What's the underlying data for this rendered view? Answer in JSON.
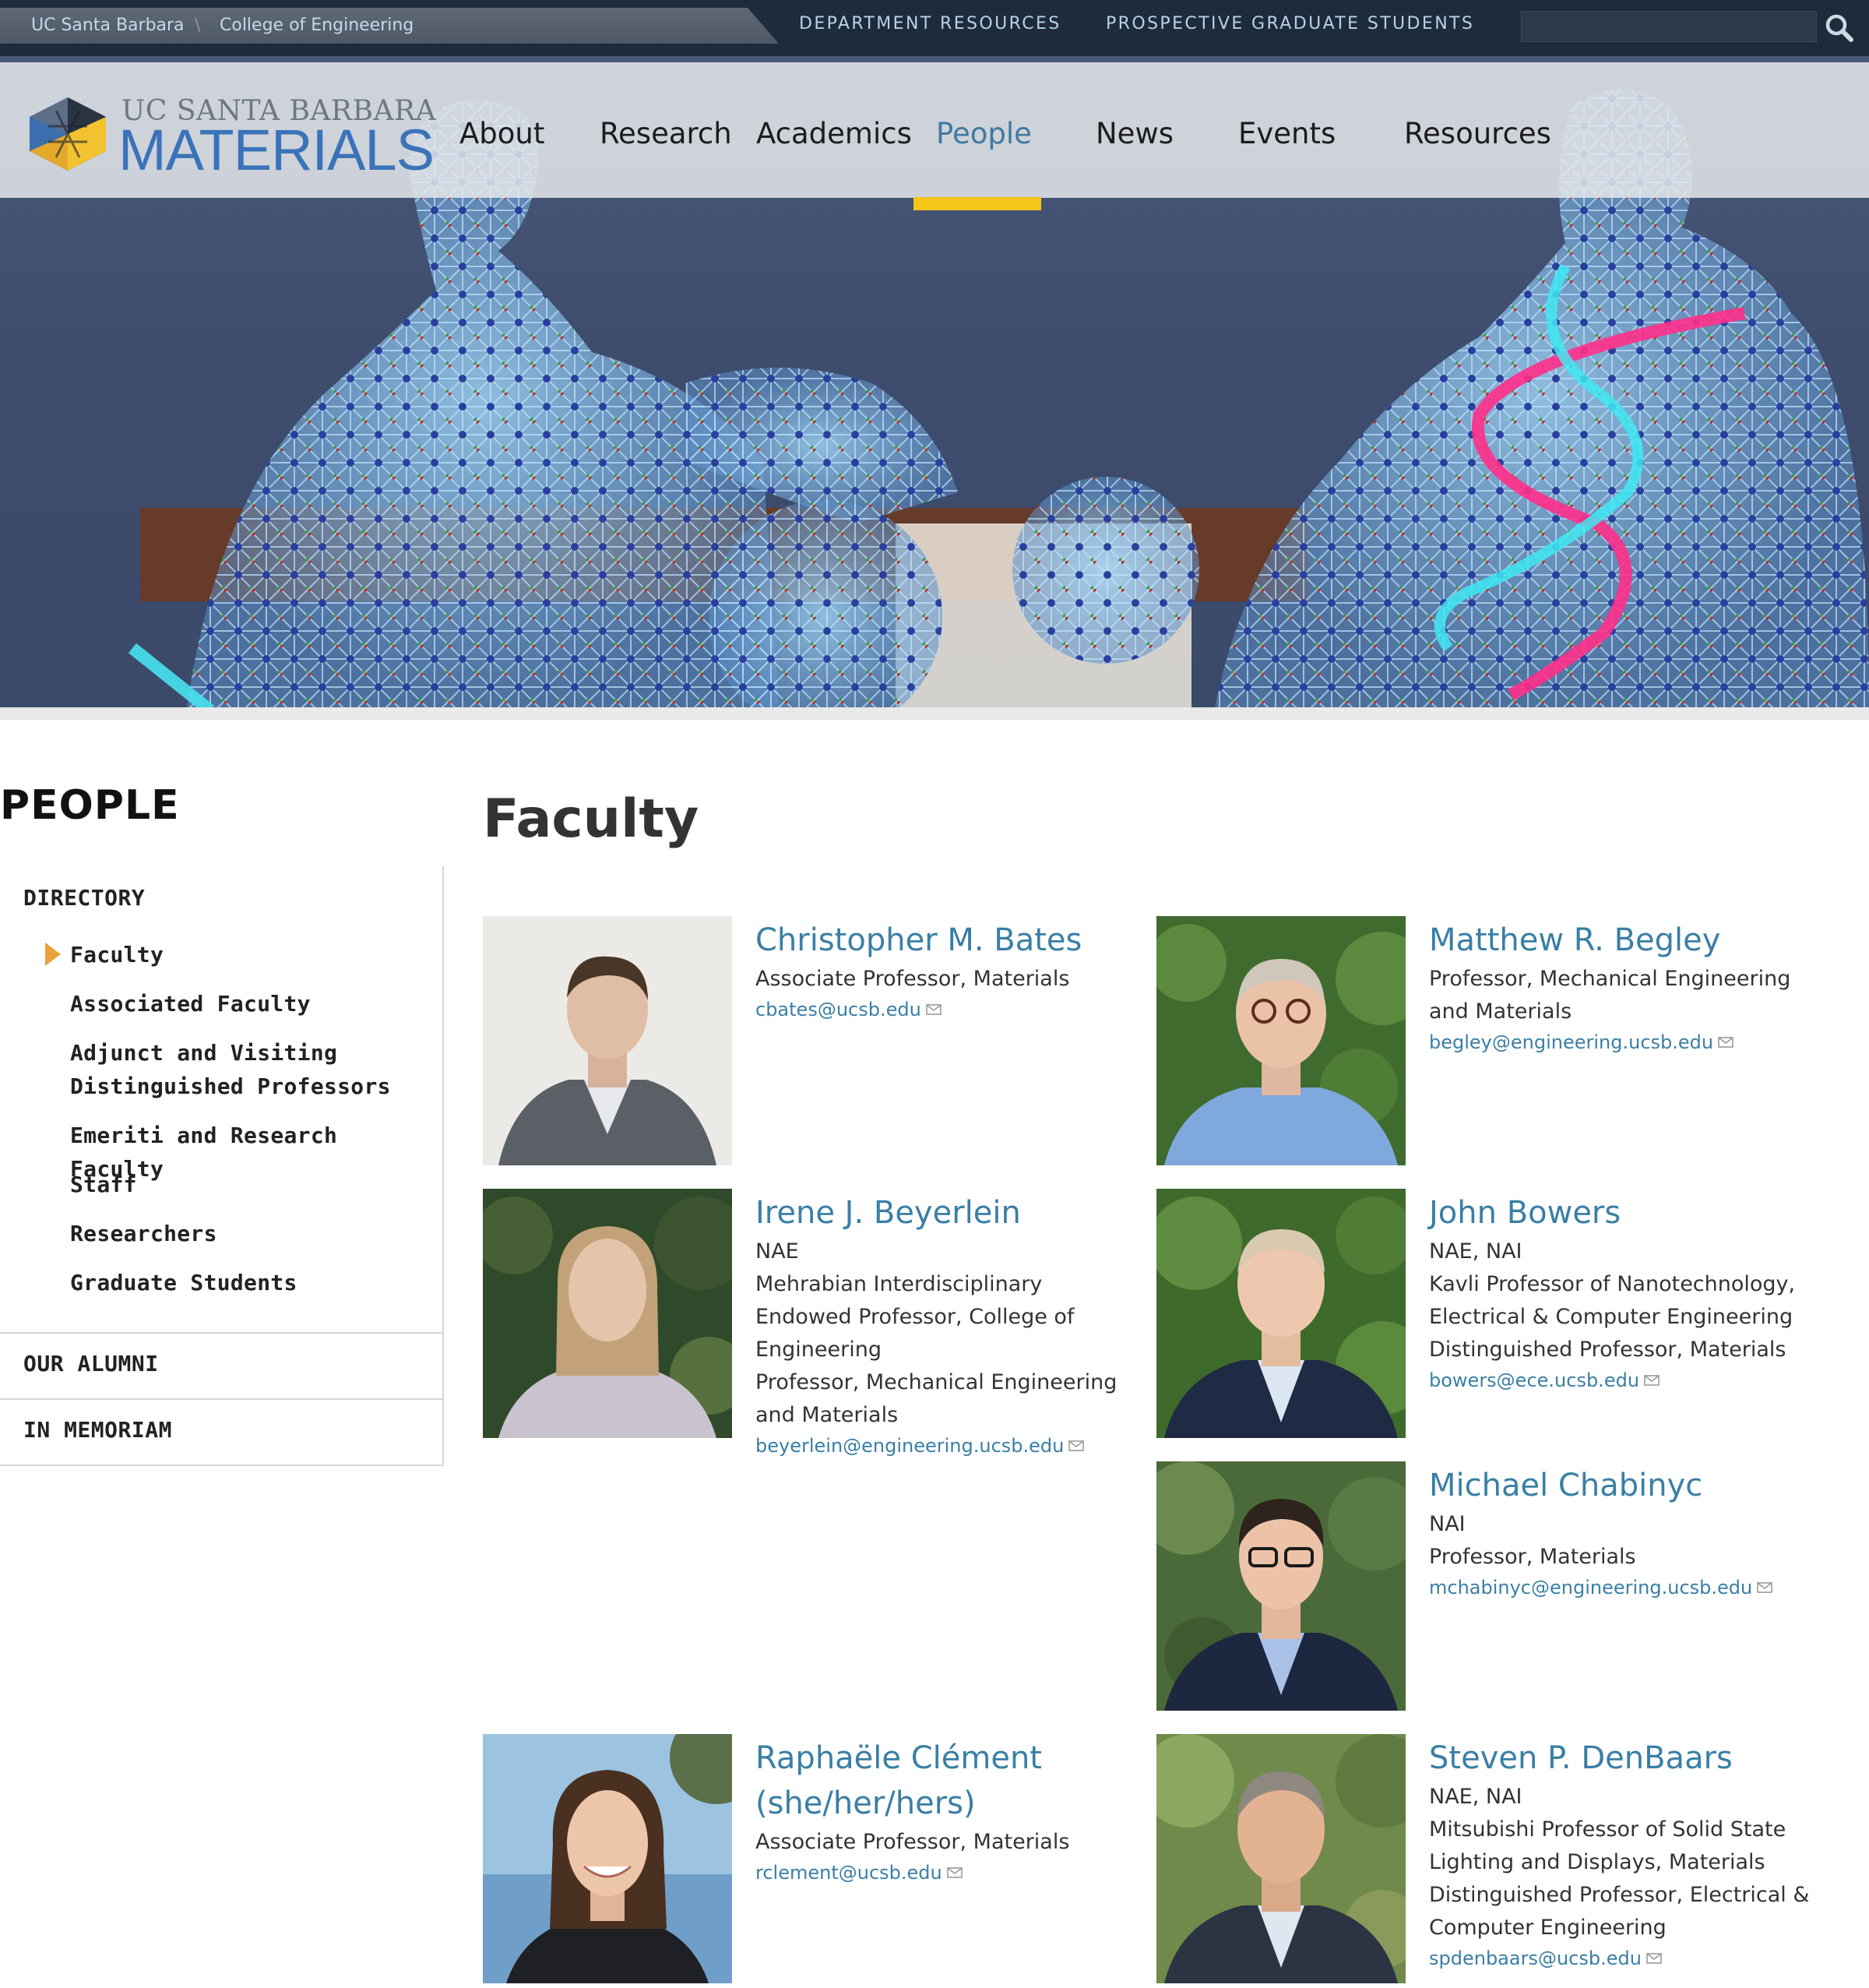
{
  "utility": {
    "crumb_ucsb": "UC Santa Barbara",
    "crumb_sep": "\\",
    "crumb_coe": "College of Engineering",
    "dept_resources": "DEPARTMENT RESOURCES",
    "prospective": "PROSPECTIVE GRADUATE STUDENTS",
    "search_icon": "search-icon"
  },
  "logo": {
    "top": "UC SANTA BARBARA",
    "bottom": "MATERIALS"
  },
  "nav": {
    "about": "About",
    "research": "Research",
    "academics": "Academics",
    "people": "People",
    "news": "News",
    "events": "Events",
    "resources": "Resources",
    "active": "People",
    "active_color": "#f5c518"
  },
  "sidebar": {
    "title": "PEOPLE",
    "directory": "DIRECTORY",
    "links": [
      "Faculty",
      "Associated Faculty",
      "Adjunct and Visiting Distinguished Professors",
      "Emeriti and Research Faculty",
      "Staff",
      "Researchers",
      "Graduate Students"
    ],
    "alumni": "OUR ALUMNI",
    "memoriam": "IN MEMORIAM",
    "current_marker_color": "#e8a33b"
  },
  "main": {
    "title": "Faculty",
    "faculty": [
      {
        "name": "Christopher M. Bates",
        "lines": [
          "Associate Professor, Materials"
        ],
        "email": "cbates@ucsb.edu"
      },
      {
        "name": "Matthew R. Begley",
        "lines": [
          "Professor, Mechanical Engineering",
          "and Materials"
        ],
        "email": "begley@engineering.ucsb.edu"
      },
      {
        "name": "Irene J. Beyerlein",
        "lines": [
          "NAE",
          "Mehrabian Interdisciplinary",
          "Endowed Professor, College of",
          "Engineering",
          "Professor, Mechanical Engineering",
          "and Materials"
        ],
        "email": "beyerlein@engineering.ucsb.edu"
      },
      {
        "name": "John Bowers",
        "lines": [
          "NAE, NAI",
          "Kavli Professor of Nanotechnology,",
          "Electrical & Computer Engineering",
          "Distinguished Professor, Materials"
        ],
        "email": "bowers@ece.ucsb.edu"
      },
      {
        "name": "Michael Chabinyc",
        "lines": [
          "NAI",
          "Professor, Materials"
        ],
        "email": "mchabinyc@engineering.ucsb.edu"
      },
      {
        "name": "Raphaële Clément",
        "name2": "(she/her/hers)",
        "lines": [
          "Associate Professor, Materials"
        ],
        "email": "rclement@ucsb.edu"
      },
      {
        "name": "Steven P. DenBaars",
        "lines": [
          "NAE, NAI",
          "Mitsubishi Professor of Solid State",
          "Lighting and Displays, Materials",
          "Distinguished Professor, Electrical &",
          "Computer Engineering"
        ],
        "email": "spdenbaars@ucsb.edu"
      }
    ],
    "email_icon": "mail-icon",
    "link_color": "#3a7fa5"
  }
}
